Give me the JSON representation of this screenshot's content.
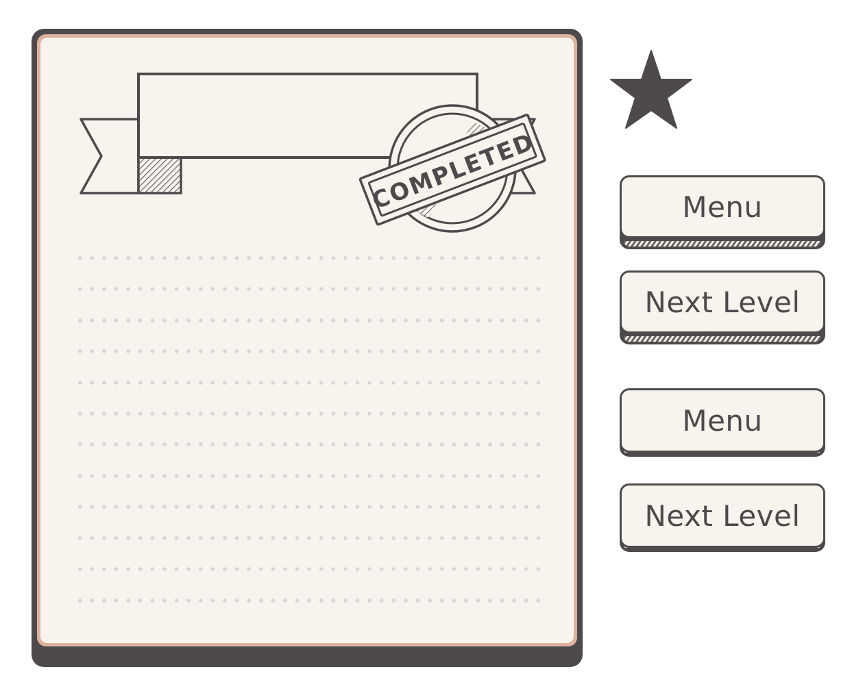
{
  "card": {
    "stamp_text": "COMPLETED",
    "banner_text": ""
  },
  "star": {
    "icon": "star-icon",
    "color": "#4e494b"
  },
  "buttons": {
    "menu_label": "Menu",
    "next_level_label": "Next Level",
    "menu_label_alt": "Menu",
    "next_level_label_alt": "Next Level"
  },
  "colors": {
    "ink": "#4e494b",
    "paper": "#f8f4ed",
    "card_rim": "#dcb3a0",
    "dots": "#d8d5d2"
  }
}
